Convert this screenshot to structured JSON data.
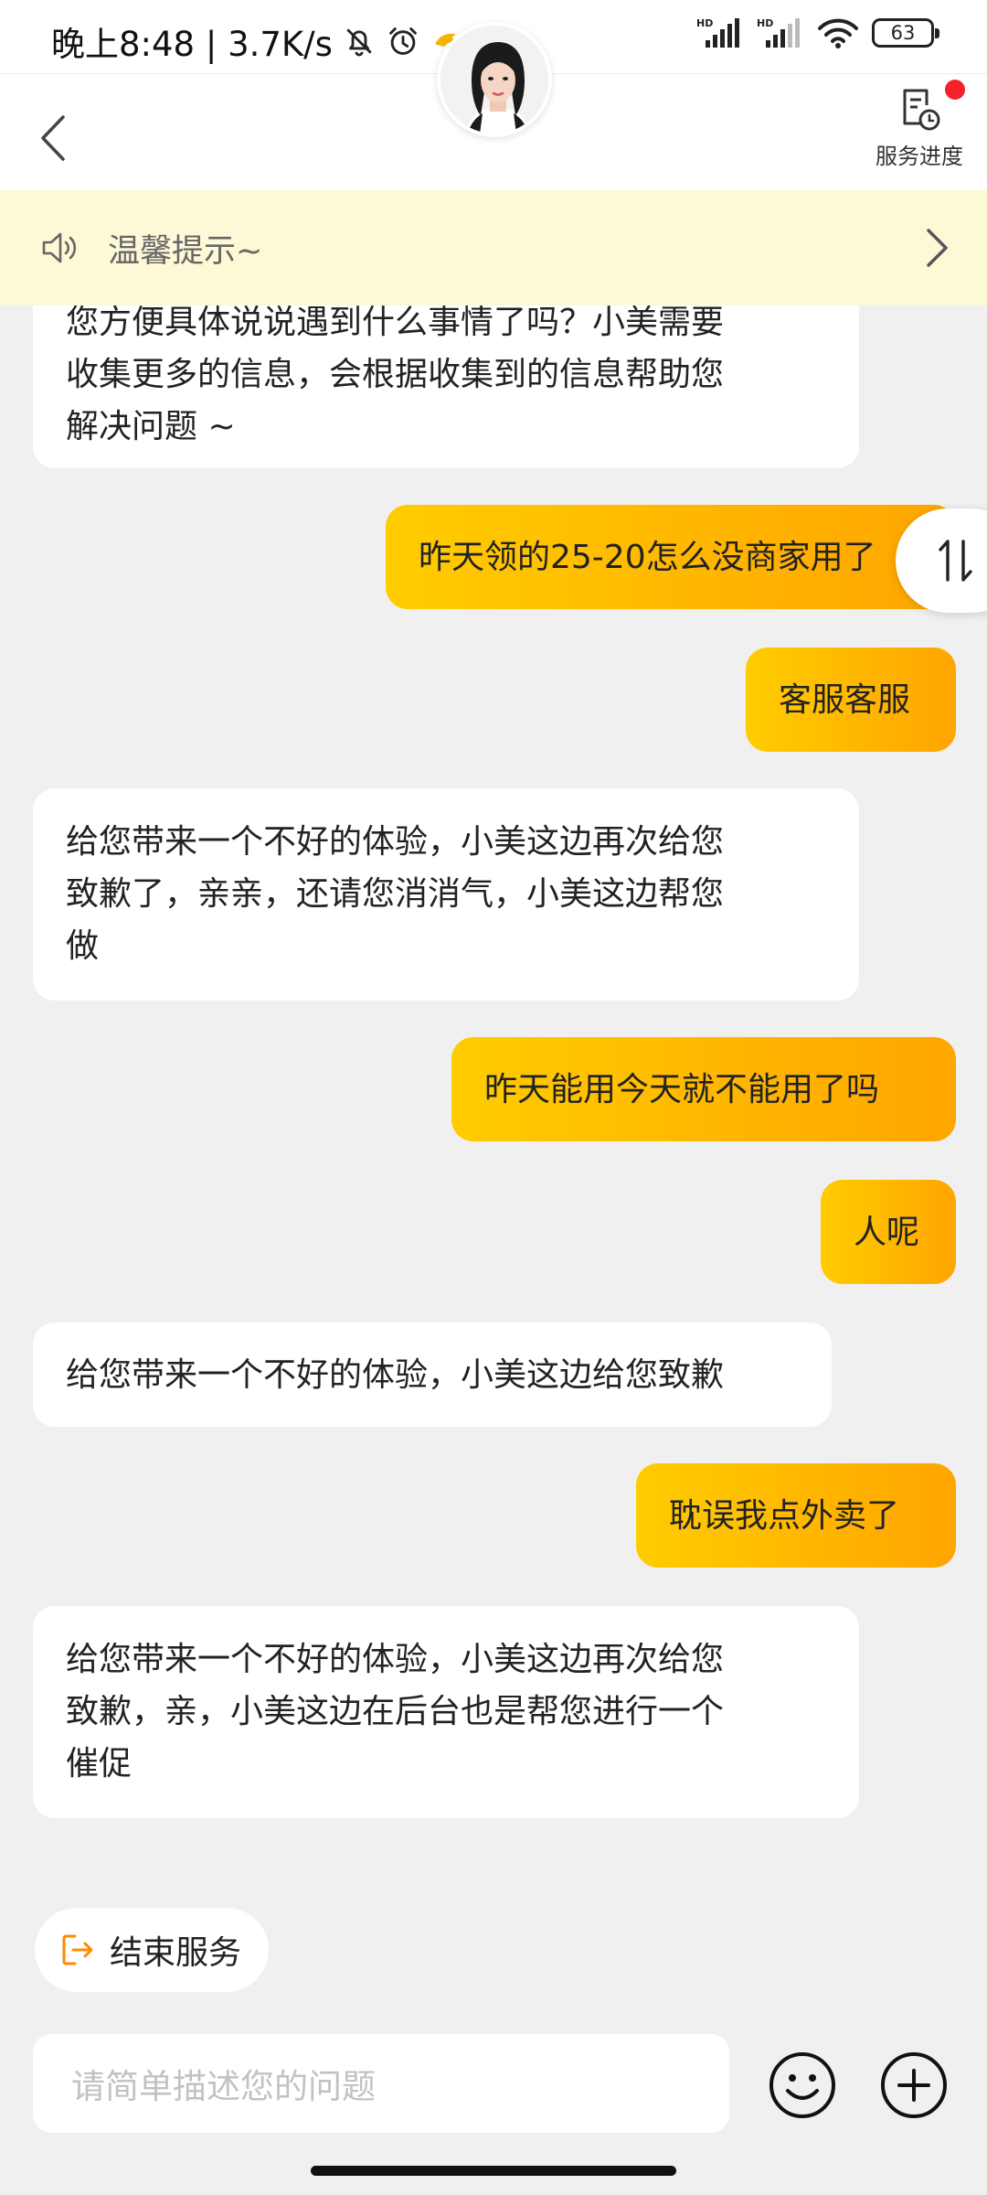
{
  "status_bar": {
    "time_speed": "晚上8:48 | 3.7K/s",
    "signal_labels": [
      "HD",
      "HD"
    ],
    "battery": "63"
  },
  "header": {
    "service_progress_label": "服务进度"
  },
  "notice": {
    "text": "温馨提示~"
  },
  "messages": [
    {
      "side": "in",
      "lines": [
        "您方便具体说说遇到什么事情了吗？小美需要",
        "收集更多的信息，会根据收集到的信息帮助您",
        "解决问题 ~"
      ]
    },
    {
      "side": "out",
      "text": "昨天领的25-20怎么没商家用了"
    },
    {
      "side": "out",
      "text": "客服客服"
    },
    {
      "side": "in",
      "lines": [
        "给您带来一个不好的体验，小美这边再次给您",
        "致歉了，亲亲，还请您消消气，小美这边帮您",
        "做"
      ]
    },
    {
      "side": "out",
      "text": "昨天能用今天就不能用了吗"
    },
    {
      "side": "out",
      "text": "人呢"
    },
    {
      "side": "in",
      "lines": [
        "给您带来一个不好的体验，小美这边给您致歉"
      ]
    },
    {
      "side": "out",
      "text": "耽误我点外卖了"
    },
    {
      "side": "in",
      "lines": [
        "给您带来一个不好的体验，小美这边再次给您",
        "致歉，亲，小美这边在后台也是帮您进行一个",
        "催促"
      ]
    }
  ],
  "end_service": {
    "label": "结束服务"
  },
  "input": {
    "placeholder": "请简单描述您的问题"
  },
  "colors": {
    "accent_gradient_start": "#ffcc00",
    "accent_gradient_end": "#ffa500",
    "notice_bg": "#fdf8d6",
    "badge_red": "#f5222d",
    "end_icon_orange": "#ff8a00"
  }
}
